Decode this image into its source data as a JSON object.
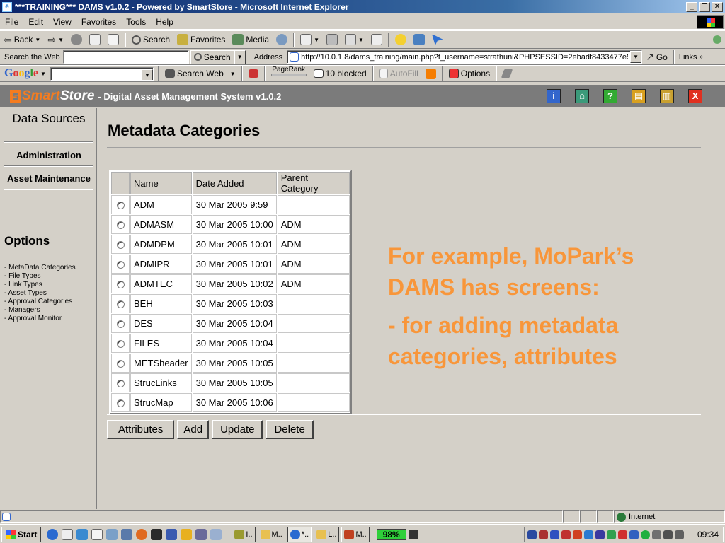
{
  "window": {
    "title": "***TRAINING*** DAMS v1.0.2 - Powered by SmartStore - Microsoft Internet Explorer"
  },
  "menu": [
    "File",
    "Edit",
    "View",
    "Favorites",
    "Tools",
    "Help"
  ],
  "toolbar": {
    "back": "Back",
    "search": "Search",
    "favorites": "Favorites",
    "media": "Media"
  },
  "addressbar": {
    "search_label": "Search the Web",
    "search_value": "",
    "search_button": "Search",
    "address_label": "Address",
    "url": "http://10.0.1.8/dams_training/main.php?t_username=strathuni&PHPSESSID=2ebadf8433477e9a0d5",
    "go": "Go",
    "links": "Links"
  },
  "googlebar": {
    "logo": [
      "G",
      "o",
      "o",
      "g",
      "l",
      "e"
    ],
    "search_web": "Search Web",
    "pagerank": "PageRank",
    "blocked": "10 blocked",
    "autofill": "AutoFill",
    "options": "Options"
  },
  "app": {
    "brand_smart": "Smart",
    "brand_store": "Store",
    "subtitle": "- Digital Asset Management System v1.0.2",
    "icons": [
      {
        "glyph": "i",
        "color": "#3366cc"
      },
      {
        "glyph": "⌂",
        "color": "#3b9a7a"
      },
      {
        "glyph": "?",
        "color": "#33aa33"
      },
      {
        "glyph": "▤",
        "color": "#d8a020"
      },
      {
        "glyph": "▥",
        "color": "#c8a030"
      },
      {
        "glyph": "X",
        "color": "#e03020"
      }
    ]
  },
  "nav": {
    "data_sources": "Data Sources",
    "administration": "Administration",
    "asset_maintenance": "Asset Maintenance",
    "options_title": "Options",
    "options": [
      "- MetaData Categories",
      "- File Types",
      "- Link Types",
      "- Asset Types",
      "- Approval Categories",
      "- Managers",
      "- Approval Monitor"
    ]
  },
  "main": {
    "title": "Metadata Categories",
    "columns": [
      "Name",
      "Date Added",
      "Parent Category"
    ],
    "rows": [
      {
        "name": "ADM",
        "date": "30 Mar 2005 9:59",
        "parent": ""
      },
      {
        "name": "ADMASM",
        "date": "30 Mar 2005 10:00",
        "parent": "ADM"
      },
      {
        "name": "ADMDPM",
        "date": "30 Mar 2005 10:01",
        "parent": "ADM"
      },
      {
        "name": "ADMIPR",
        "date": "30 Mar 2005 10:01",
        "parent": "ADM"
      },
      {
        "name": "ADMTEC",
        "date": "30 Mar 2005 10:02",
        "parent": "ADM"
      },
      {
        "name": "BEH",
        "date": "30 Mar 2005 10:03",
        "parent": ""
      },
      {
        "name": "DES",
        "date": "30 Mar 2005 10:04",
        "parent": ""
      },
      {
        "name": "FILES",
        "date": "30 Mar 2005 10:04",
        "parent": ""
      },
      {
        "name": "METSheader",
        "date": "30 Mar 2005 10:05",
        "parent": ""
      },
      {
        "name": "StrucLinks",
        "date": "30 Mar 2005 10:05",
        "parent": ""
      },
      {
        "name": "StrucMap",
        "date": "30 Mar 2005 10:06",
        "parent": ""
      }
    ],
    "buttons": {
      "attributes": "Attributes",
      "add": "Add",
      "update": "Update",
      "delete": "Delete"
    }
  },
  "overlay": {
    "line1": "For example, MoPark’s",
    "line2": "DAMS has screens:",
    "line3": "- for adding metadata",
    "line4": "categories,  attributes"
  },
  "statusbar": {
    "zone": "Internet"
  },
  "taskbar": {
    "start": "Start",
    "tasks": [
      "I..",
      "M..",
      "*..",
      "L..",
      "M.."
    ],
    "battery": "98%",
    "clock": "09:34"
  }
}
